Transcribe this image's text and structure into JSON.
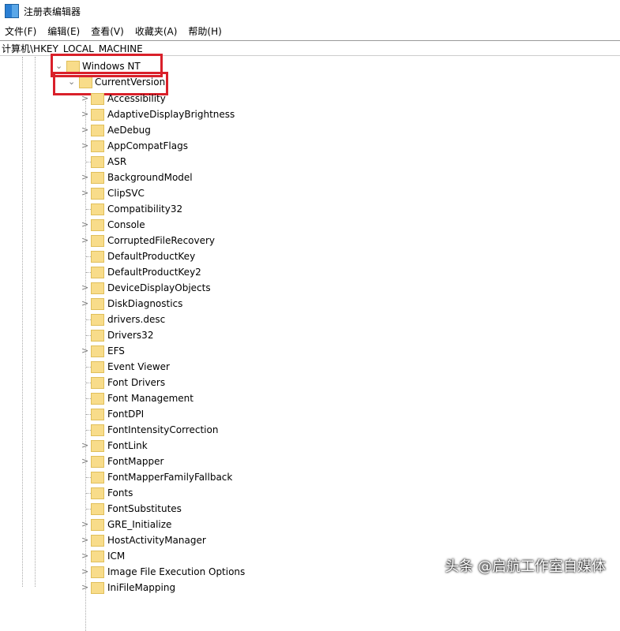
{
  "window": {
    "title": "注册表编辑器"
  },
  "menu": [
    "文件(F)",
    "编辑(E)",
    "查看(V)",
    "收藏夹(A)",
    "帮助(H)"
  ],
  "address": "计算机\\HKEY_LOCAL_MACHINE",
  "tree": {
    "parent": "Windows NT",
    "current": "CurrentVersion",
    "children": [
      {
        "label": "Accessibility",
        "expandable": true
      },
      {
        "label": "AdaptiveDisplayBrightness",
        "expandable": true
      },
      {
        "label": "AeDebug",
        "expandable": true
      },
      {
        "label": "AppCompatFlags",
        "expandable": true
      },
      {
        "label": "ASR",
        "expandable": false
      },
      {
        "label": "BackgroundModel",
        "expandable": true
      },
      {
        "label": "ClipSVC",
        "expandable": true
      },
      {
        "label": "Compatibility32",
        "expandable": false
      },
      {
        "label": "Console",
        "expandable": true
      },
      {
        "label": "CorruptedFileRecovery",
        "expandable": true
      },
      {
        "label": "DefaultProductKey",
        "expandable": false
      },
      {
        "label": "DefaultProductKey2",
        "expandable": false
      },
      {
        "label": "DeviceDisplayObjects",
        "expandable": true
      },
      {
        "label": "DiskDiagnostics",
        "expandable": true
      },
      {
        "label": "drivers.desc",
        "expandable": false
      },
      {
        "label": "Drivers32",
        "expandable": false
      },
      {
        "label": "EFS",
        "expandable": true
      },
      {
        "label": "Event Viewer",
        "expandable": false
      },
      {
        "label": "Font Drivers",
        "expandable": false
      },
      {
        "label": "Font Management",
        "expandable": false
      },
      {
        "label": "FontDPI",
        "expandable": false
      },
      {
        "label": "FontIntensityCorrection",
        "expandable": false
      },
      {
        "label": "FontLink",
        "expandable": true
      },
      {
        "label": "FontMapper",
        "expandable": true
      },
      {
        "label": "FontMapperFamilyFallback",
        "expandable": false
      },
      {
        "label": "Fonts",
        "expandable": false
      },
      {
        "label": "FontSubstitutes",
        "expandable": false
      },
      {
        "label": "GRE_Initialize",
        "expandable": true
      },
      {
        "label": "HostActivityManager",
        "expandable": true
      },
      {
        "label": "ICM",
        "expandable": true
      },
      {
        "label": "Image File Execution Options",
        "expandable": true
      },
      {
        "label": "IniFileMapping",
        "expandable": true
      }
    ]
  },
  "watermark": "头条 @启航工作室自媒体",
  "colors": {
    "highlight": "#d9202a",
    "folder": "#f8dc8a"
  }
}
